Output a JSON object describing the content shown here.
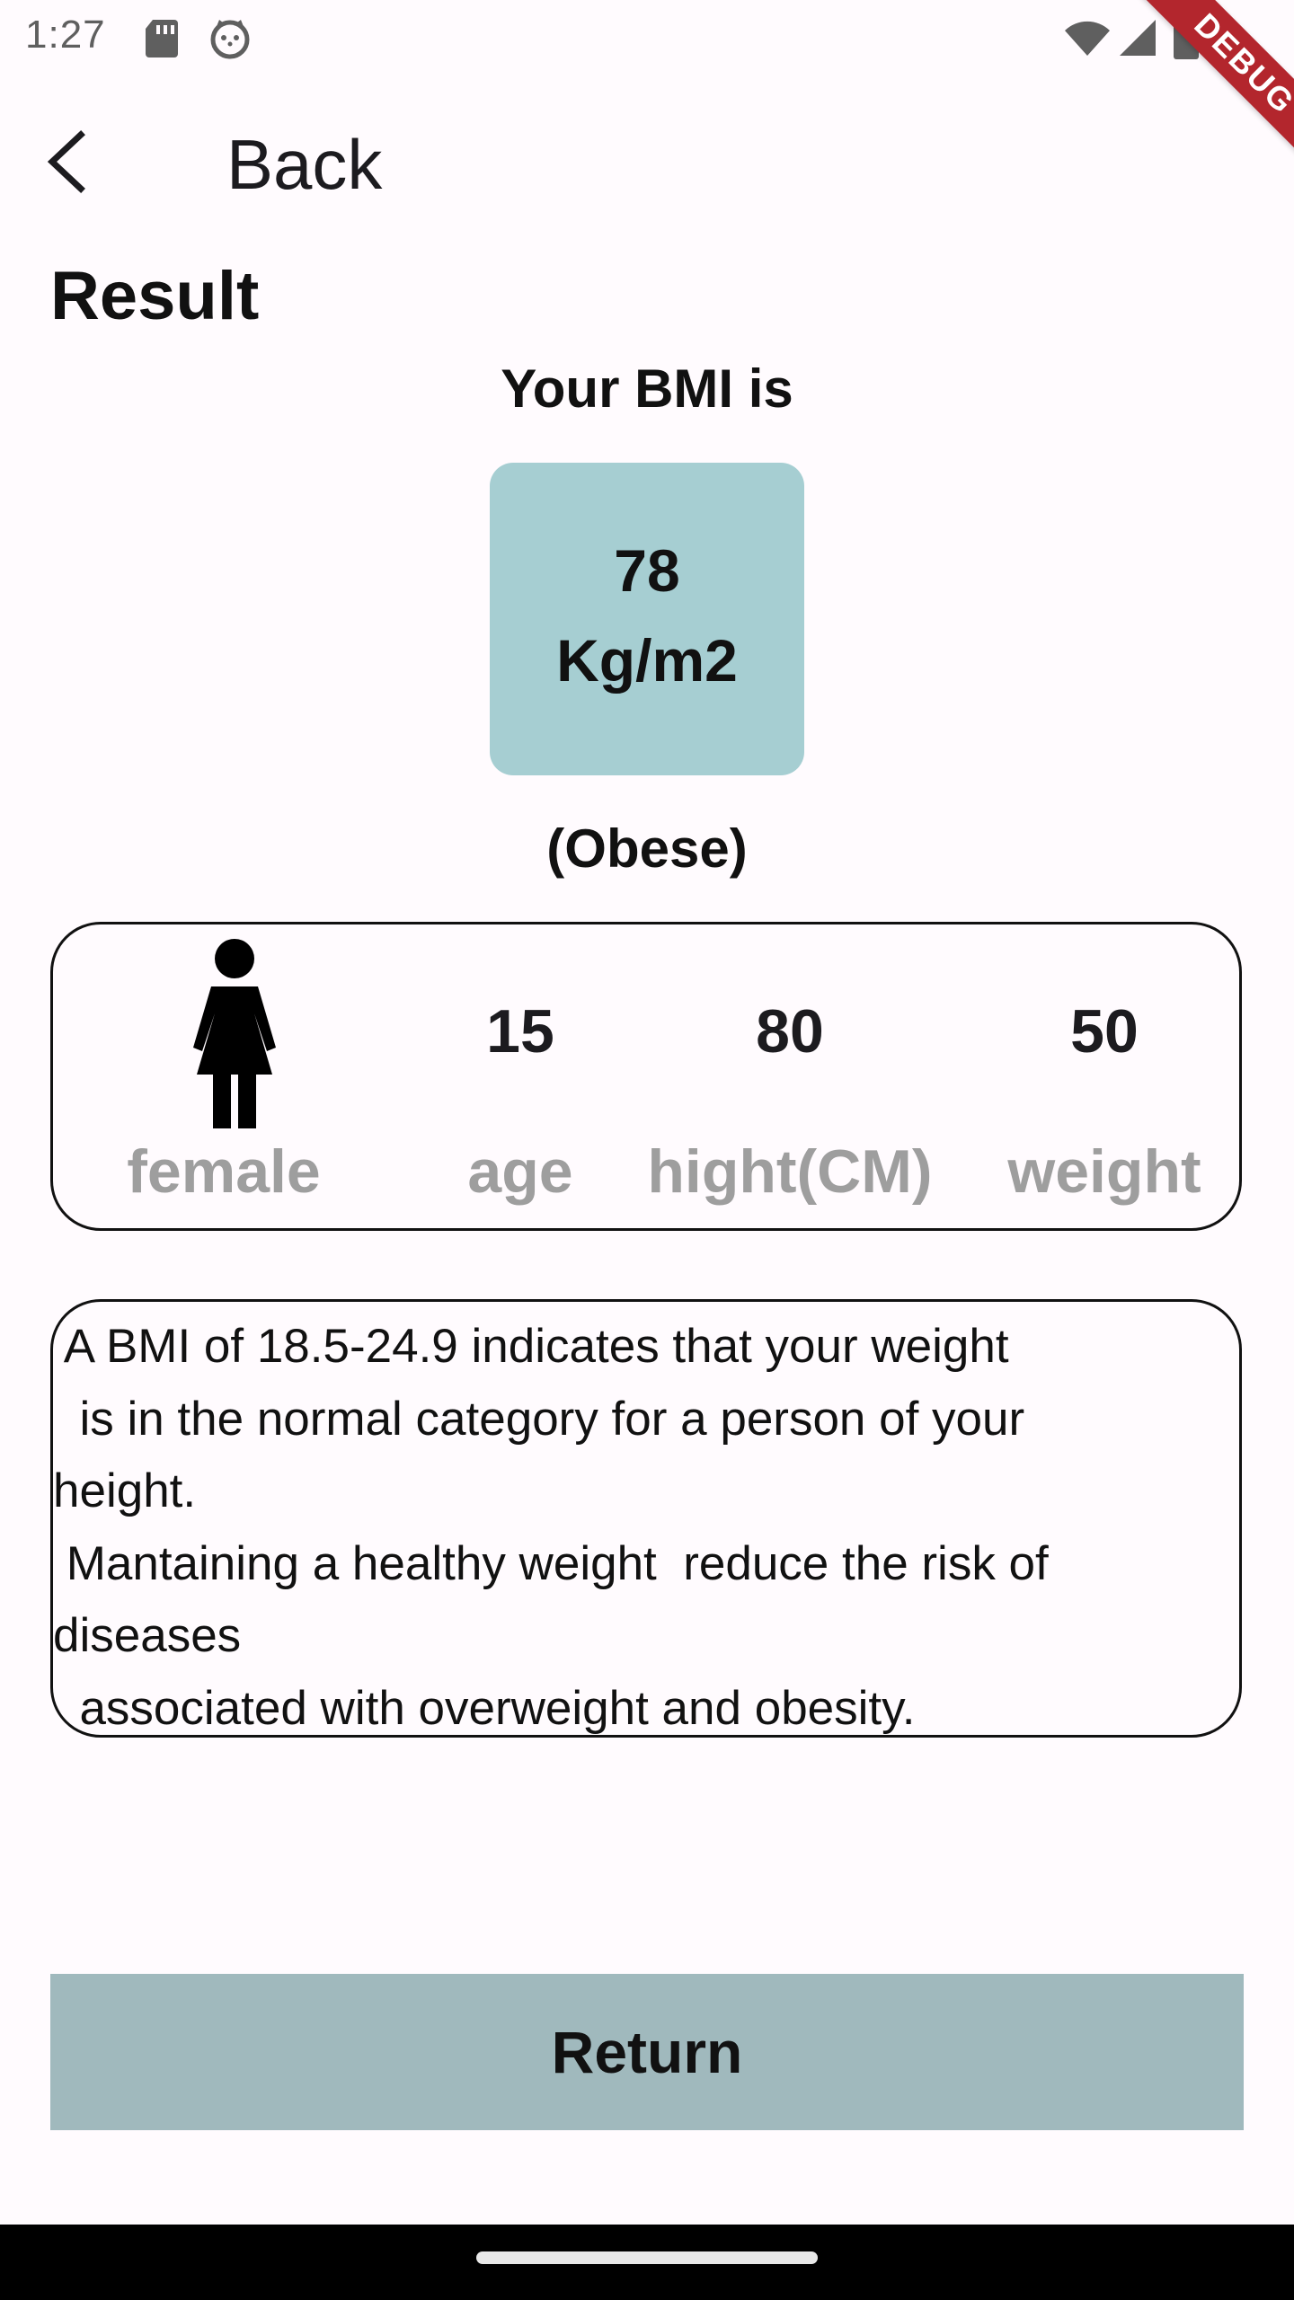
{
  "status_bar": {
    "time": "1:27",
    "icons": [
      "sd-card-icon",
      "cat-face-icon",
      "wifi-icon",
      "cell-signal-icon",
      "battery-icon"
    ],
    "debug_banner": "DEBUG"
  },
  "app_bar": {
    "back_label": "Back",
    "back_icon": "chevron-left-icon"
  },
  "result": {
    "title": "Result",
    "caption": "Your BMI is",
    "bmi_value": "78",
    "bmi_unit": "Kg/m2",
    "category": "(Obese)",
    "box_color": "#A6CED2"
  },
  "info": {
    "gender_icon": "female-person-icon",
    "gender_label": "female",
    "age_value": "15",
    "age_label": "age",
    "height_value": "80",
    "height_label": "hight(CM)",
    "weight_value": "50",
    "weight_label": "weight",
    "label_color": "#9E9E9E"
  },
  "description": " A BMI of 18.5-24.9 indicates that your weight\n  is in the normal category for a person of your\nheight.\n Mantaining a healthy weight  reduce the risk of\ndiseases\n  associated with overweight and obesity.",
  "actions": {
    "return_label": "Return",
    "return_color": "#A0B9BD"
  }
}
